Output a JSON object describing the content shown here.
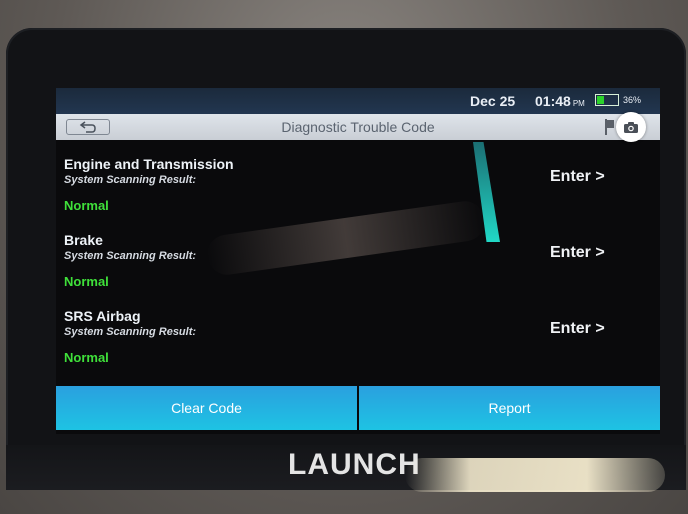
{
  "status_bar": {
    "date": "Dec 25",
    "time": "01:48",
    "ampm": "PM",
    "battery": "36%",
    "battery_level": 0.36
  },
  "header": {
    "title": "Diagnostic Trouble Code"
  },
  "systems": [
    {
      "name": "Engine and Transmission",
      "subtitle": "System Scanning Result:",
      "status": "Normal",
      "action": "Enter >"
    },
    {
      "name": "Brake",
      "subtitle": "System Scanning Result:",
      "status": "Normal",
      "action": "Enter >"
    },
    {
      "name": "SRS Airbag",
      "subtitle": "System Scanning Result:",
      "status": "Normal",
      "action": "Enter >"
    }
  ],
  "actions": {
    "clear_code": "Clear Code",
    "report": "Report"
  },
  "brand": "LAUNCH",
  "colors": {
    "status_normal": "#3fe03a",
    "action_button": "#2aa0df",
    "battery": "#2bd22b"
  }
}
